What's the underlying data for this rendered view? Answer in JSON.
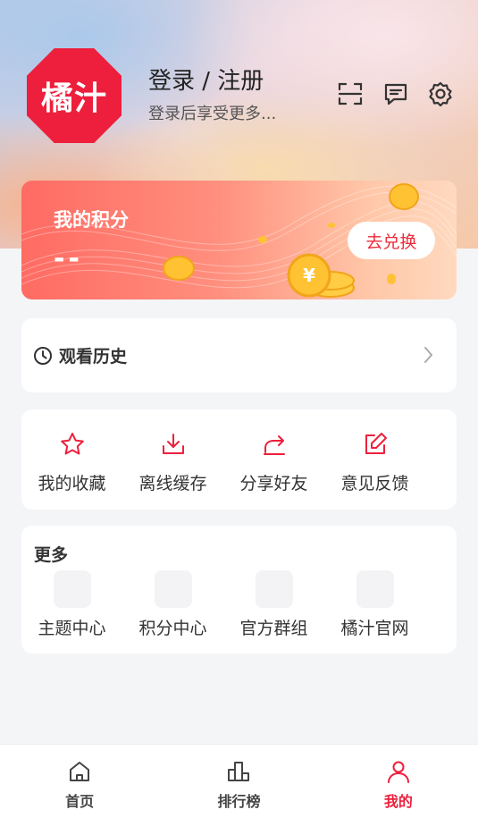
{
  "profile": {
    "logo_text": "橘汁",
    "login_title": "登录 / 注册",
    "login_subtitle": "登录后享受更多..."
  },
  "top_icons": [
    "scan-icon",
    "message-icon",
    "settings-icon"
  ],
  "points_card": {
    "title": "我的积分",
    "value": "--",
    "button_label": "去兑换"
  },
  "history": {
    "label": "观看历史"
  },
  "actions": [
    {
      "label": "我的收藏",
      "icon": "star-icon"
    },
    {
      "label": "离线缓存",
      "icon": "download-icon"
    },
    {
      "label": "分享好友",
      "icon": "share-icon"
    },
    {
      "label": "意见反馈",
      "icon": "feedback-edit-icon"
    }
  ],
  "more": {
    "title": "更多",
    "items": [
      {
        "label": "主题中心"
      },
      {
        "label": "积分中心"
      },
      {
        "label": "官方群组"
      },
      {
        "label": "橘汁官网"
      }
    ]
  },
  "tabbar": {
    "items": [
      {
        "label": "首页",
        "icon": "home-icon"
      },
      {
        "label": "排行榜",
        "icon": "ranking-icon"
      },
      {
        "label": "我的",
        "icon": "user-icon",
        "active": true
      }
    ]
  },
  "colors": {
    "accent": "#ee1f3c",
    "points_gradient_start": "#ff6b63",
    "points_gradient_end": "#ffd9bf",
    "page_background": "#f4f5f7"
  }
}
